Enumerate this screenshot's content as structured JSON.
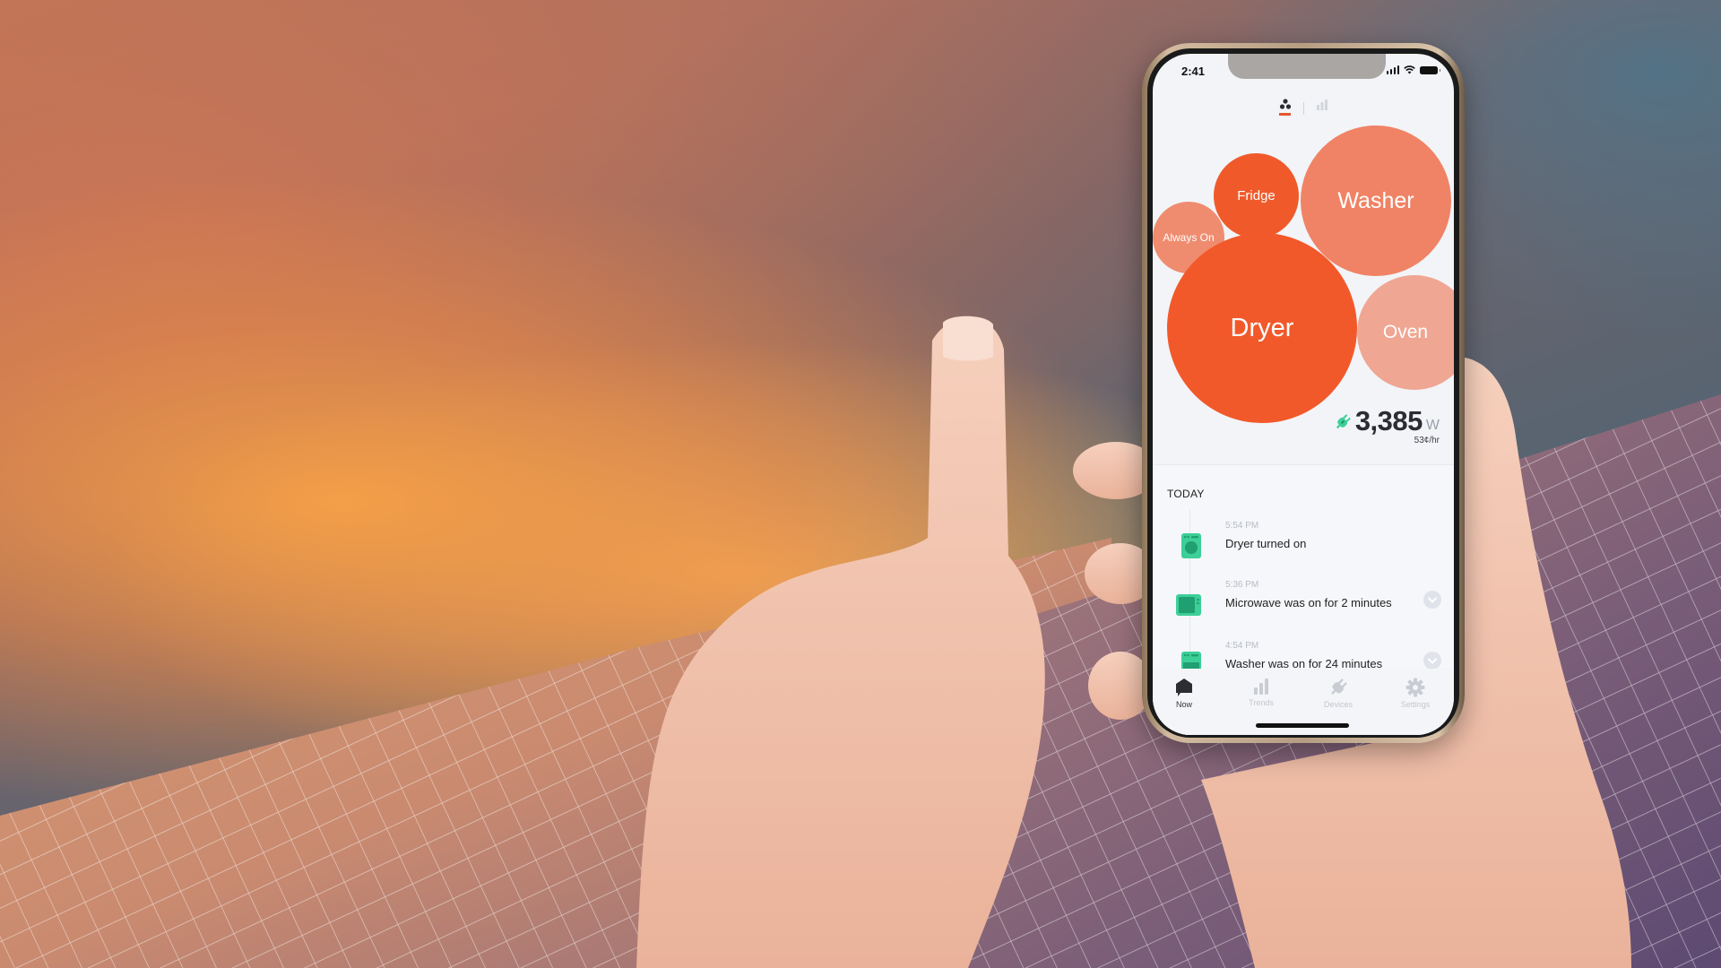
{
  "app": {
    "status_bar": {
      "time": "2:41"
    },
    "view_toggle": [
      {
        "name": "bubbles",
        "active": true
      },
      {
        "name": "bars",
        "active": false
      }
    ],
    "bubbles": [
      {
        "label": "Always On",
        "color": "#ef8c6f"
      },
      {
        "label": "Fridge",
        "color": "#f05a2a"
      },
      {
        "label": "Washer",
        "color": "#f08365"
      },
      {
        "label": "Dryer",
        "color": "#f2592a"
      },
      {
        "label": "Oven",
        "color": "#efa692"
      }
    ],
    "power": {
      "value": "3,385",
      "unit": "W",
      "cost": "53¢/hr",
      "icon": "plug-icon",
      "icon_color": "#3dcf98"
    },
    "list": {
      "section_title": "TODAY",
      "events": [
        {
          "time": "5:54 PM",
          "text": "Dryer turned on",
          "icon": "dryer-icon",
          "expandable": false
        },
        {
          "time": "5:36 PM",
          "text": "Microwave was on for 2 minutes",
          "icon": "microwave-icon",
          "expandable": true
        },
        {
          "time": "4:54 PM",
          "text": "Washer was on for 24 minutes",
          "icon": "washer-icon",
          "expandable": true
        }
      ]
    },
    "tabs": [
      {
        "label": "Now",
        "icon": "home-icon",
        "active": true
      },
      {
        "label": "Trends",
        "icon": "bar-chart-icon",
        "active": false
      },
      {
        "label": "Devices",
        "icon": "plug-icon",
        "active": false
      },
      {
        "label": "Settings",
        "icon": "gear-icon",
        "active": false
      }
    ],
    "colors": {
      "accent": "#e4572e",
      "device_green": "#3dcf98"
    }
  }
}
